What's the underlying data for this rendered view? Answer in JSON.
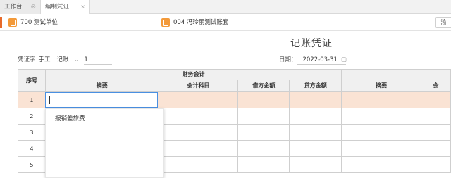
{
  "tabs": [
    {
      "label": "工作台",
      "close": "⊗"
    },
    {
      "label": "编制凭证",
      "close": "×"
    }
  ],
  "company_bar": {
    "unit1": "700 测试单位",
    "unit2": "004 冯玲丽测试账套",
    "right_button": "渝"
  },
  "voucher": {
    "title": "记账凭证",
    "voucher_word_label": "凭证字",
    "voucher_word_value": "手工",
    "voucher_type": "记账",
    "voucher_number": "1",
    "date_label": "日期：",
    "date_value": "2022-03-31"
  },
  "table": {
    "index_header": "序号",
    "group_header": "财务会计",
    "columns": [
      "摘要",
      "会计科目",
      "借方金额",
      "贷方金额",
      "摘要",
      "会"
    ],
    "rows": [
      "1",
      "2",
      "3",
      "4",
      "5"
    ]
  },
  "dropdown": {
    "items": [
      "报销差旅费"
    ]
  },
  "colors": {
    "accent": "#e76a2b",
    "active_row": "#fae3d4",
    "focus_border": "#4a90e2"
  }
}
